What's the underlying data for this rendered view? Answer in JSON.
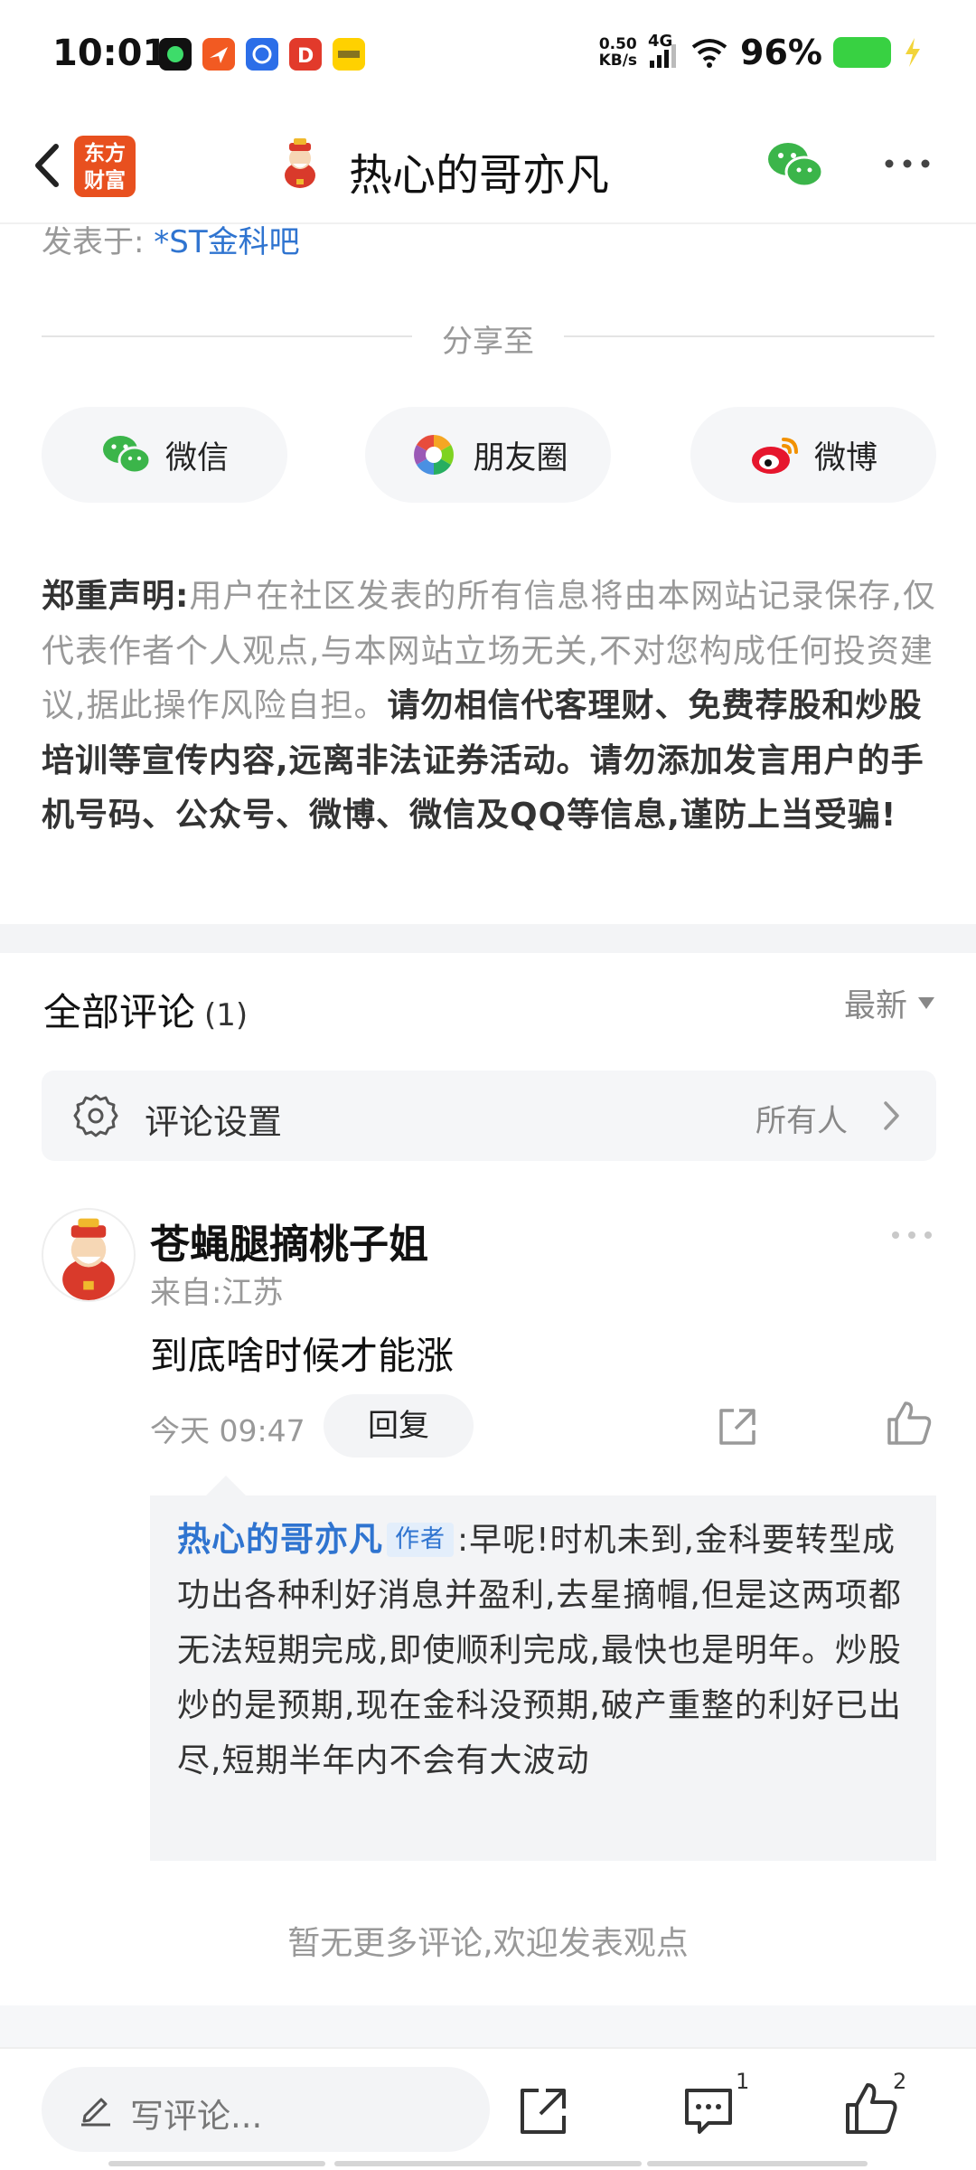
{
  "status_bar": {
    "time": "10:01",
    "net_speed_value": "0.50",
    "net_speed_unit": "KB/s",
    "signal_type": "4G",
    "battery": "96%",
    "app_icons": [
      "music-app-icon",
      "messenger-app-icon",
      "browser-app-icon",
      "video-app-icon",
      "meituan-app-icon"
    ]
  },
  "header": {
    "logo_text": "东方财富",
    "title": "热心的哥亦凡"
  },
  "post": {
    "posted_in_label": "发表于:",
    "bar_name": "*ST金科吧"
  },
  "share": {
    "title": "分享至",
    "buttons": [
      {
        "label": "微信",
        "icon": "wechat-icon"
      },
      {
        "label": "朋友圈",
        "icon": "moments-icon"
      },
      {
        "label": "微博",
        "icon": "weibo-icon"
      }
    ]
  },
  "disclaimer": {
    "heading": "郑重声明:",
    "normal": "用户在社区发表的所有信息将由本网站记录保存,仅代表作者个人观点,与本网站立场无关,不对您构成任何投资建议,据此操作风险自担。",
    "bold": "请勿相信代客理财、免费荐股和炒股培训等宣传内容,远离非法证券活动。请勿添加发言用户的手机号码、公众号、微博、微信及QQ等信息,谨防上当受骗!"
  },
  "comments": {
    "title": "全部评论",
    "count": "(1)",
    "sort_label": "最新",
    "settings_label": "评论设置",
    "settings_value": "所有人",
    "items": [
      {
        "author": "苍蝇腿摘桃子姐",
        "location": "来自:江苏",
        "text": "到底啥时候才能涨",
        "time": "今天 09:47",
        "reply_label": "回复",
        "reply": {
          "author": "热心的哥亦凡",
          "tag": "作者",
          "text": ":早呢!时机未到,金科要转型成功出各种利好消息并盈利,去星摘帽,但是这两项都无法短期完成,即使顺利完成,最快也是明年。炒股炒的是预期,现在金科没预期,破产重整的利好已出尽,短期半年内不会有大波动"
        }
      }
    ],
    "no_more": "暂无更多评论,欢迎发表观点"
  },
  "bottom_bar": {
    "write_placeholder": "写评论...",
    "comment_count": "1",
    "like_count": "2"
  },
  "colors": {
    "link_blue": "#2f74d0",
    "brand_orange": "#e8501f",
    "battery_green": "#38d142"
  }
}
